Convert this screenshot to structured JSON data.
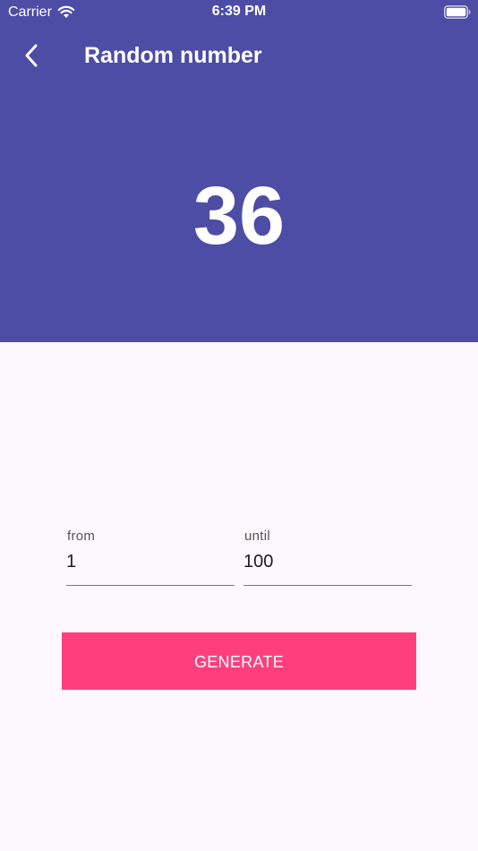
{
  "status_bar": {
    "carrier": "Carrier",
    "time": "6:39 PM",
    "wifi_icon": "wifi-icon",
    "battery_icon": "battery-icon"
  },
  "app_bar": {
    "title": "Random number",
    "back_icon": "chevron-left-icon"
  },
  "result": {
    "value": "36"
  },
  "form": {
    "from_label": "from",
    "from_value": "1",
    "until_label": "until",
    "until_value": "100"
  },
  "actions": {
    "generate_label": "GENERATE"
  },
  "colors": {
    "header_bg": "#4D4DA6",
    "accent": "#FF3F7C",
    "page_bg": "#FDF8FE"
  }
}
